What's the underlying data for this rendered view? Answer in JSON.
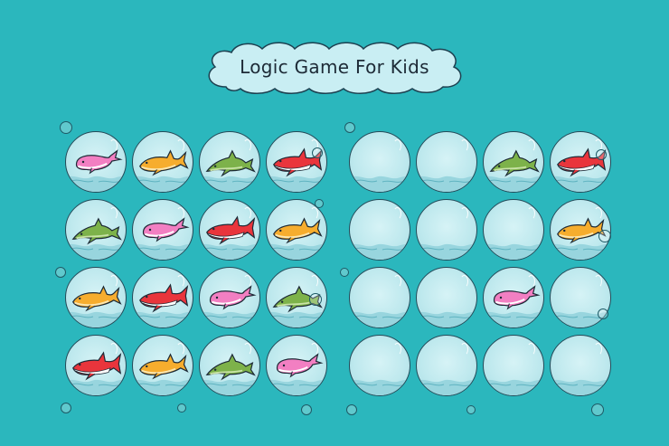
{
  "title": "Logic Game For Kids",
  "colors": {
    "background": "#2bb7bd",
    "bubble": "#bfe9ee",
    "pink_whale": "#f27fc2",
    "orange_shark": "#f6ad2e",
    "green_dolphin": "#7db24a",
    "red_shark": "#e9353c"
  },
  "left_grid": [
    [
      "pink-whale",
      "orange-shark",
      "green-dolphin",
      "red-shark"
    ],
    [
      "green-dolphin",
      "pink-whale",
      "red-shark",
      "orange-shark"
    ],
    [
      "orange-shark",
      "red-shark",
      "pink-whale",
      "green-dolphin"
    ],
    [
      "red-shark",
      "orange-shark",
      "green-dolphin",
      "pink-whale"
    ]
  ],
  "right_grid": [
    [
      "empty",
      "empty",
      "green-dolphin",
      "red-shark"
    ],
    [
      "empty",
      "empty",
      "empty",
      "orange-shark"
    ],
    [
      "empty",
      "empty",
      "pink-whale",
      "empty"
    ],
    [
      "empty",
      "empty",
      "empty",
      "empty"
    ]
  ]
}
